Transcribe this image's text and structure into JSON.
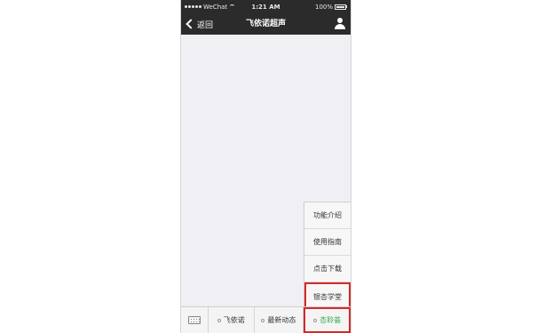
{
  "status_bar": {
    "carrier": "WeChat",
    "time": "1:21 AM",
    "battery": "100%"
  },
  "nav": {
    "back_label": "返回",
    "title": "飞依诺超声"
  },
  "popup_menu": {
    "items": [
      "功能介绍",
      "使用指南",
      "点击下载",
      "银杏学堂"
    ],
    "add_symbol": "+"
  },
  "tab_bar": {
    "tabs": [
      "飞依诺",
      "最新动态",
      "杏聆荟"
    ]
  },
  "colors": {
    "highlight_red": "#d42a2a",
    "active_green": "#3aaa52",
    "bar_dark": "#2b2b2b"
  }
}
